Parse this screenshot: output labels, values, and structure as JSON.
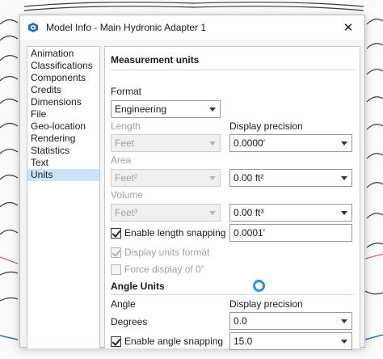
{
  "window": {
    "title": "Model Info - Main Hydronic Adapter 1",
    "close_glyph": "✕",
    "app_icon": "sketchup-logo-icon"
  },
  "sidebar": {
    "items": [
      {
        "label": "Animation",
        "selected": false
      },
      {
        "label": "Classifications",
        "selected": false
      },
      {
        "label": "Components",
        "selected": false
      },
      {
        "label": "Credits",
        "selected": false
      },
      {
        "label": "Dimensions",
        "selected": false
      },
      {
        "label": "File",
        "selected": false
      },
      {
        "label": "Geo-location",
        "selected": false
      },
      {
        "label": "Rendering",
        "selected": false
      },
      {
        "label": "Statistics",
        "selected": false
      },
      {
        "label": "Text",
        "selected": false
      },
      {
        "label": "Units",
        "selected": true
      }
    ]
  },
  "units": {
    "measurement_title": "Measurement units",
    "format_label": "Format",
    "format_value": "Engineering",
    "length_label": "Length",
    "length_value": "Feet",
    "display_precision_label": "Display precision",
    "length_precision_value": "0.0000'",
    "area_label": "Area",
    "area_value": "Feet²",
    "area_precision_value": "0.00 ft²",
    "volume_label": "Volume",
    "volume_value": "Feet³",
    "volume_precision_value": "0.00 ft³",
    "enable_length_snapping_label": "Enable length snapping",
    "enable_length_snapping_checked": true,
    "length_snapping_value": "0.0001'",
    "display_units_format_label": "Display units format",
    "display_units_format_checked": true,
    "force_display_label": "Force display of 0\"",
    "force_display_checked": false,
    "angle_title": "Angle Units",
    "angle_label": "Angle",
    "angle_precision_label": "Display precision",
    "degrees_label": "Degrees",
    "angle_precision_value": "0.0",
    "enable_angle_snapping_label": "Enable angle snapping",
    "enable_angle_snapping_checked": true,
    "angle_snapping_value": "15.0"
  },
  "colors": {
    "selection": "#cce4f7",
    "busy_indicator": "#2c8fe8",
    "disabled_text": "#a0a0a0"
  }
}
